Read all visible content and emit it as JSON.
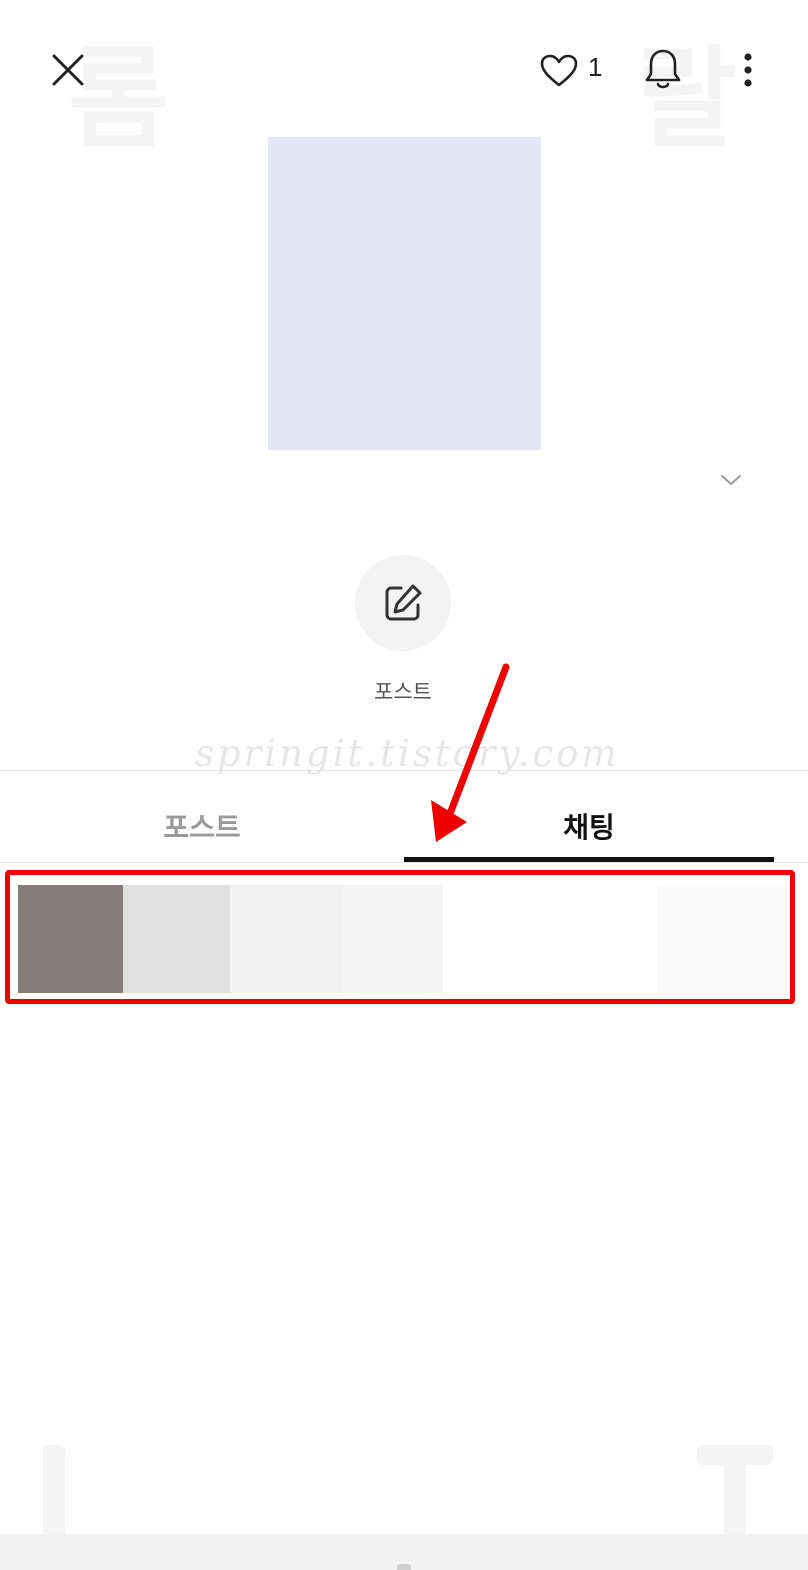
{
  "header": {
    "close_icon": "close-icon",
    "like_icon": "heart-icon",
    "like_count": "1",
    "bell_icon": "bell-icon",
    "more_icon": "more-vertical-icon"
  },
  "profile": {
    "cover_color": "#e4e6f7",
    "expand_icon": "chevron-down-icon"
  },
  "actions": {
    "write_icon": "edit-icon",
    "write_label": "포스트"
  },
  "watermark": "springit.tistory.com",
  "tabs": [
    {
      "label": "포스트",
      "active": false
    },
    {
      "label": "채팅",
      "active": true
    }
  ],
  "chat_preview": {
    "colors": [
      "#867d78",
      "#e0e0e0",
      "#f1f1f1",
      "#f4f4f4",
      "#ffffff",
      "#fefefe",
      "#fafafa"
    ]
  },
  "annotation": {
    "highlight_color": "#ee0000"
  }
}
